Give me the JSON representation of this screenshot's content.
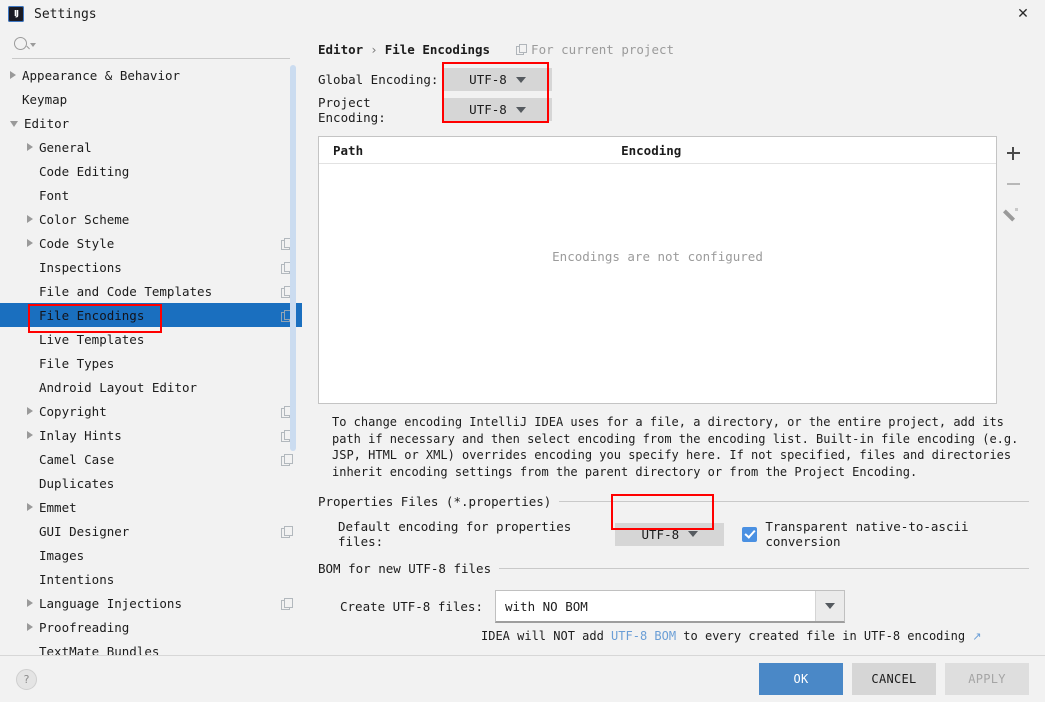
{
  "window": {
    "title": "Settings",
    "logo_icon": "intellij-idea-logo",
    "close_icon": "close-icon"
  },
  "search": {
    "value": "",
    "placeholder": "",
    "icon": "search-icon",
    "dropdown_icon": "chevron-down-icon"
  },
  "sidebar": {
    "items": [
      {
        "label": "Appearance & Behavior",
        "level": 0,
        "arrow": "collapsed",
        "copy": false,
        "selected": false
      },
      {
        "label": "Keymap",
        "level": 0,
        "arrow": "none",
        "copy": false,
        "selected": false
      },
      {
        "label": "Editor",
        "level": 0,
        "arrow": "expanded",
        "copy": false,
        "selected": false
      },
      {
        "label": "General",
        "level": 1,
        "arrow": "collapsed",
        "copy": false,
        "selected": false
      },
      {
        "label": "Code Editing",
        "level": 1,
        "arrow": "none",
        "copy": false,
        "selected": false
      },
      {
        "label": "Font",
        "level": 1,
        "arrow": "none",
        "copy": false,
        "selected": false
      },
      {
        "label": "Color Scheme",
        "level": 1,
        "arrow": "collapsed",
        "copy": false,
        "selected": false
      },
      {
        "label": "Code Style",
        "level": 1,
        "arrow": "collapsed",
        "copy": true,
        "selected": false
      },
      {
        "label": "Inspections",
        "level": 1,
        "arrow": "none",
        "copy": true,
        "selected": false
      },
      {
        "label": "File and Code Templates",
        "level": 1,
        "arrow": "none",
        "copy": true,
        "selected": false
      },
      {
        "label": "File Encodings",
        "level": 1,
        "arrow": "none",
        "copy": true,
        "selected": true
      },
      {
        "label": "Live Templates",
        "level": 1,
        "arrow": "none",
        "copy": false,
        "selected": false
      },
      {
        "label": "File Types",
        "level": 1,
        "arrow": "none",
        "copy": false,
        "selected": false
      },
      {
        "label": "Android Layout Editor",
        "level": 1,
        "arrow": "none",
        "copy": false,
        "selected": false
      },
      {
        "label": "Copyright",
        "level": 1,
        "arrow": "collapsed",
        "copy": true,
        "selected": false
      },
      {
        "label": "Inlay Hints",
        "level": 1,
        "arrow": "collapsed",
        "copy": true,
        "selected": false
      },
      {
        "label": "Camel Case",
        "level": 1,
        "arrow": "none",
        "copy": true,
        "selected": false
      },
      {
        "label": "Duplicates",
        "level": 1,
        "arrow": "none",
        "copy": false,
        "selected": false
      },
      {
        "label": "Emmet",
        "level": 1,
        "arrow": "collapsed",
        "copy": false,
        "selected": false
      },
      {
        "label": "GUI Designer",
        "level": 1,
        "arrow": "none",
        "copy": true,
        "selected": false
      },
      {
        "label": "Images",
        "level": 1,
        "arrow": "none",
        "copy": false,
        "selected": false
      },
      {
        "label": "Intentions",
        "level": 1,
        "arrow": "none",
        "copy": false,
        "selected": false
      },
      {
        "label": "Language Injections",
        "level": 1,
        "arrow": "collapsed",
        "copy": true,
        "selected": false
      },
      {
        "label": "Proofreading",
        "level": 1,
        "arrow": "collapsed",
        "copy": false,
        "selected": false
      },
      {
        "label": "TextMate Bundles",
        "level": 1,
        "arrow": "none",
        "copy": false,
        "selected": false
      }
    ]
  },
  "breadcrumb": {
    "parent": "Editor",
    "separator": "›",
    "current": "File Encodings",
    "scope_note": "For current project",
    "scope_icon": "copy-icon"
  },
  "encodings": {
    "global_label": "Global Encoding:",
    "global_value": "UTF-8",
    "project_label": "Project Encoding:",
    "project_value": "UTF-8"
  },
  "table": {
    "columns": [
      "Path",
      "Encoding"
    ],
    "rows": [],
    "empty_text": "Encodings are not configured",
    "toolbar": {
      "add_icon": "plus-icon",
      "remove_icon": "minus-icon",
      "edit_icon": "pencil-icon"
    }
  },
  "description": "To change encoding IntelliJ IDEA uses for a file, a directory, or the entire project, add its path if necessary and then select encoding from the encoding list. Built-in file encoding (e.g. JSP, HTML or XML) overrides encoding you specify here. If not specified, files and directories inherit encoding settings from the parent directory or from the Project Encoding.",
  "properties_section": {
    "header": "Properties Files (*.properties)",
    "default_encoding_label": "Default encoding for properties files:",
    "default_encoding_value": "UTF-8",
    "checkbox_label": "Transparent native-to-ascii conversion",
    "checkbox_checked": true
  },
  "bom_section": {
    "header": "BOM for new UTF-8 files",
    "create_label": "Create UTF-8 files:",
    "create_value": "with NO BOM",
    "hint_prefix": "IDEA will NOT add ",
    "hint_link": "UTF-8 BOM",
    "hint_suffix": " to every created file in UTF-8 encoding ",
    "hint_external_icon": "↗"
  },
  "footer": {
    "help_label": "?",
    "ok_label": "OK",
    "cancel_label": "CANCEL",
    "apply_label": "APPLY",
    "apply_enabled": false
  },
  "colors": {
    "accent_blue": "#4a88c7",
    "selection_blue": "#1a6fbf",
    "annotation_red": "#ff0000",
    "checkbox_blue": "#4a90e2",
    "link_blue": "#6a9ed6",
    "window_bg": "#f2f2f2"
  }
}
